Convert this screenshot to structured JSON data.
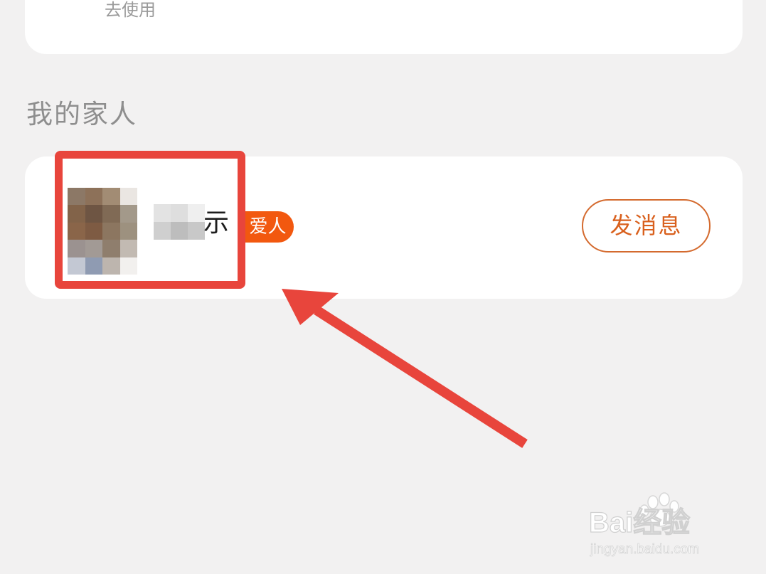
{
  "top_card": {
    "link_label": "去使用"
  },
  "section": {
    "title": "我的家人"
  },
  "family_member": {
    "name_visible_suffix": "示",
    "relation_badge": "爱人",
    "send_message_label": "发消息"
  },
  "annotation": {
    "highlight_color": "#e8453c"
  },
  "colors": {
    "accent_orange": "#f2580f",
    "button_text": "#d9601d",
    "page_background": "#f2f1f1"
  },
  "watermark": {
    "brand": "Bai经验",
    "url": "jingyan.baidu.com"
  }
}
